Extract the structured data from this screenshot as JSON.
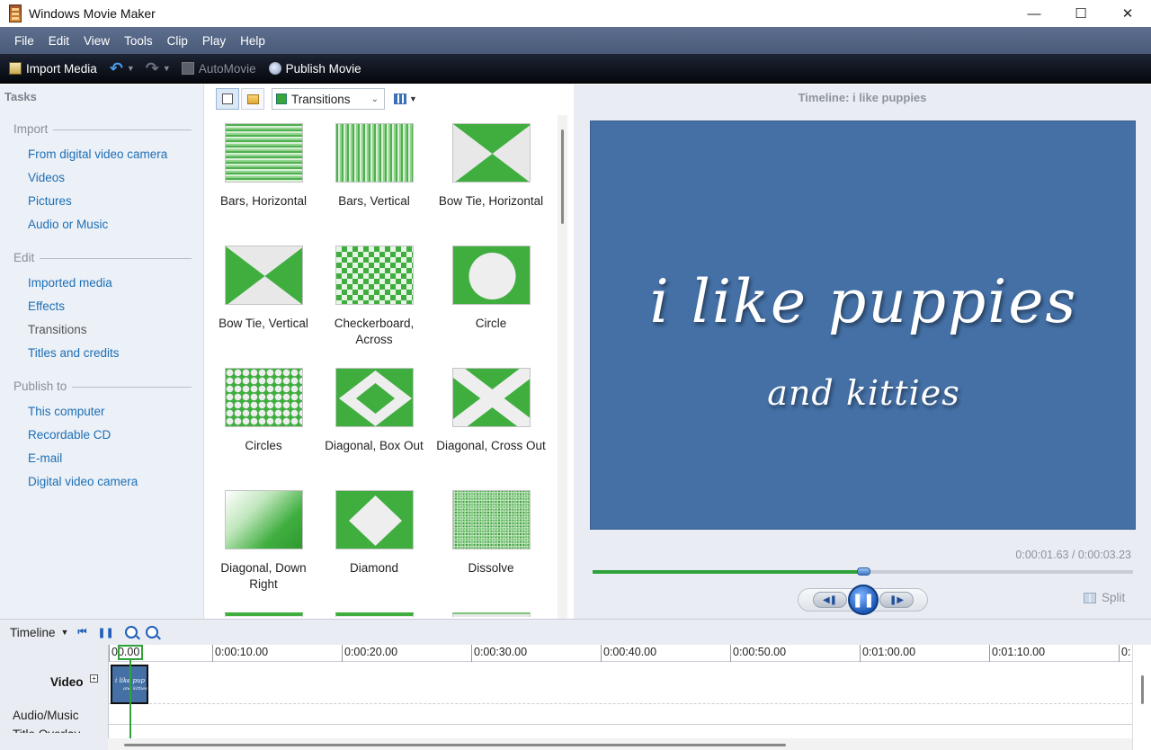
{
  "window": {
    "title": "Windows Movie Maker",
    "minimize": "—",
    "maximize": "☐",
    "close": "✕"
  },
  "menu": [
    "File",
    "Edit",
    "View",
    "Tools",
    "Clip",
    "Play",
    "Help"
  ],
  "toolbar": {
    "import_media": "Import Media",
    "automovie": "AutoMovie",
    "publish_movie": "Publish Movie"
  },
  "tasks": {
    "title": "Tasks",
    "groups": [
      {
        "label": "Import",
        "items": [
          "From digital video camera",
          "Videos",
          "Pictures",
          "Audio or Music"
        ]
      },
      {
        "label": "Edit",
        "items": [
          "Imported media",
          "Effects",
          "Transitions",
          "Titles and credits"
        ]
      },
      {
        "label": "Publish to",
        "items": [
          "This computer",
          "Recordable CD",
          "E-mail",
          "Digital video camera"
        ]
      }
    ],
    "current_item": "Transitions"
  },
  "collection": {
    "selected": "Transitions",
    "tiles": [
      "Bars, Horizontal",
      "Bars, Vertical",
      "Bow Tie, Horizontal",
      "Bow Tie, Vertical",
      "Checkerboard, Across",
      "Circle",
      "Circles",
      "Diagonal, Box Out",
      "Diagonal, Cross Out",
      "Diagonal, Down Right",
      "Diamond",
      "Dissolve"
    ]
  },
  "preview": {
    "title": "Timeline: i like puppies",
    "screen_line1": "i like puppies",
    "screen_line2": "and kitties",
    "time_current": "0:00:01.63",
    "time_total": "0:00:03.23",
    "timecode": "0:00:01.63 / 0:00:03.23",
    "progress": 0.5,
    "split": "Split",
    "accent_color": "#2fa33a",
    "screen_color": "#4470a6"
  },
  "timeline": {
    "label": "Timeline",
    "ruler": [
      "00.00",
      "0:00:10.00",
      "0:00:20.00",
      "0:00:30.00",
      "0:00:40.00",
      "0:00:50.00",
      "0:01:00.00",
      "0:01:10.00",
      "0:"
    ],
    "tracks": {
      "video": "Video",
      "audio": "Audio/Music",
      "titles": "Title Overlay"
    },
    "clip": {
      "line1": "i like pup",
      "line2": "and kitties"
    }
  }
}
